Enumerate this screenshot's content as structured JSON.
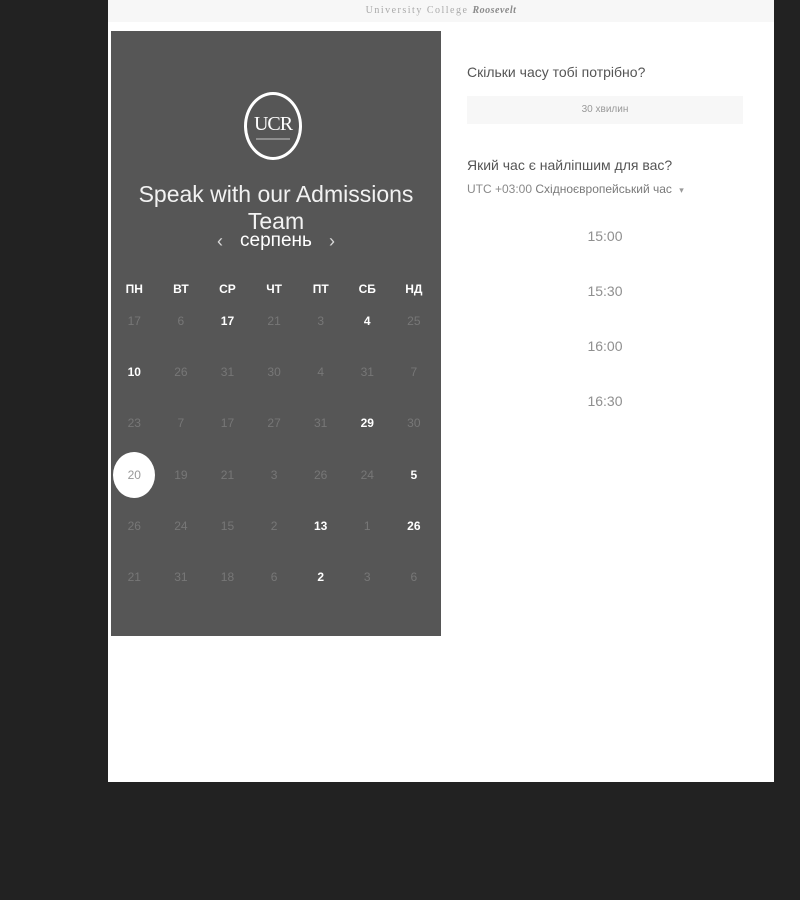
{
  "header": {
    "brand_main": "University College",
    "brand_italic": "Roosevelt"
  },
  "calendar_panel": {
    "logo_text": "UCR",
    "headline": "Speak with our Admissions Team",
    "prev_icon": "chevron-left-icon",
    "next_icon": "chevron-right-icon",
    "month": "серпень",
    "weekdays": [
      "ПН",
      "ВТ",
      "СР",
      "ЧТ",
      "ПТ",
      "СБ",
      "НД"
    ],
    "weeks": [
      [
        {
          "d": "17"
        },
        {
          "d": "6"
        },
        {
          "d": "17",
          "a": true
        },
        {
          "d": "21"
        },
        {
          "d": "3"
        },
        {
          "d": "4",
          "a": true
        },
        {
          "d": "25"
        }
      ],
      [
        {
          "d": "10",
          "a": true
        },
        {
          "d": "26"
        },
        {
          "d": "31"
        },
        {
          "d": "30"
        },
        {
          "d": "4"
        },
        {
          "d": "31"
        },
        {
          "d": "7"
        }
      ],
      [
        {
          "d": "23"
        },
        {
          "d": "7"
        },
        {
          "d": "17"
        },
        {
          "d": "27"
        },
        {
          "d": "31"
        },
        {
          "d": "29",
          "a": true
        },
        {
          "d": "30"
        }
      ],
      [
        {
          "d": "20",
          "sel": true
        },
        {
          "d": "19"
        },
        {
          "d": "21"
        },
        {
          "d": "3"
        },
        {
          "d": "26"
        },
        {
          "d": "24"
        },
        {
          "d": "5",
          "a": true
        }
      ],
      [
        {
          "d": "26"
        },
        {
          "d": "24"
        },
        {
          "d": "15"
        },
        {
          "d": "2"
        },
        {
          "d": "13",
          "a": true
        },
        {
          "d": "1"
        },
        {
          "d": "26",
          "a": true
        }
      ],
      [
        {
          "d": "21"
        },
        {
          "d": "31"
        },
        {
          "d": "18"
        },
        {
          "d": "6"
        },
        {
          "d": "2",
          "a": true
        },
        {
          "d": "3"
        },
        {
          "d": "6"
        }
      ]
    ]
  },
  "booking": {
    "duration_question": "Скільки часу тобі потрібно?",
    "duration_value": "30 хвилин",
    "time_question": "Який час є найліпшим для вас?",
    "timezone_offset": "UTC +03:00",
    "timezone_name": "Східноєвропейський час",
    "timezone_caret_icon": "caret-down-icon",
    "time_slots": [
      "15:00",
      "15:30",
      "16:00",
      "16:30"
    ]
  }
}
